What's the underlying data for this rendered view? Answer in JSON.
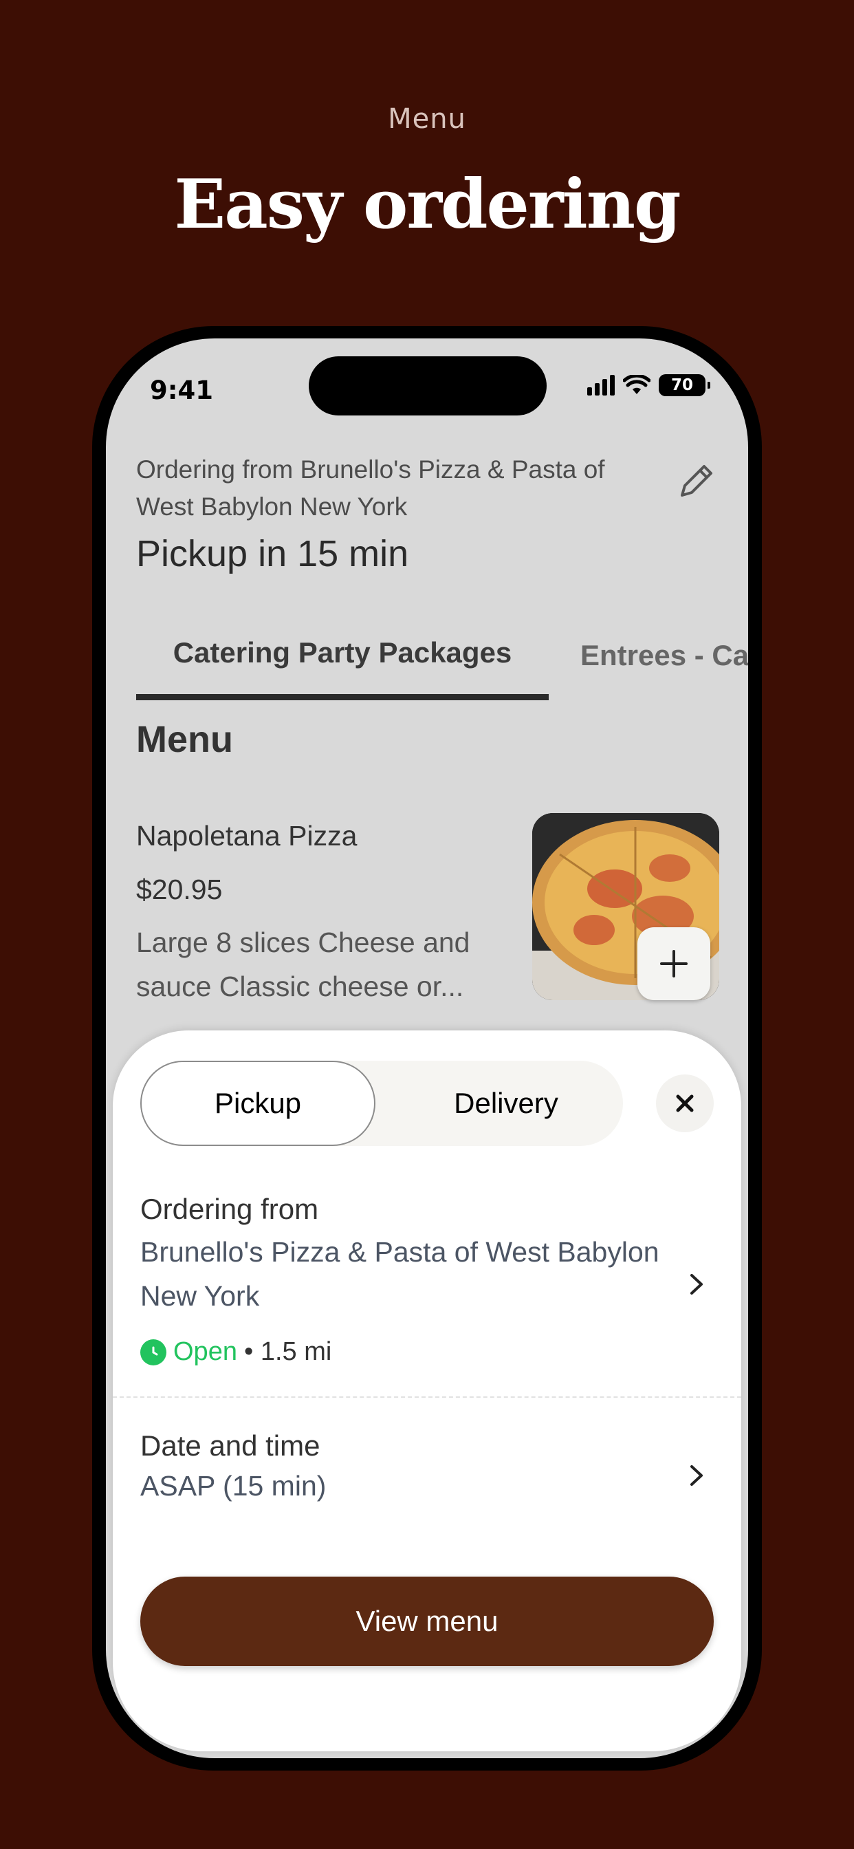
{
  "promo": {
    "subtitle": "Menu",
    "title": "Easy ordering"
  },
  "status_bar": {
    "time": "9:41",
    "battery": "70"
  },
  "header": {
    "ordering_from": "Ordering from Brunello's Pizza & Pasta of West Babylon New York",
    "pickup": "Pickup in 15 min"
  },
  "tabs": [
    {
      "label": "Catering Party Packages"
    },
    {
      "label": "Entrees - Ca"
    }
  ],
  "menu": {
    "section_title": "Menu",
    "item": {
      "name": "Napoletana Pizza",
      "price": "$20.95",
      "description": "Large 8 slices Cheese and sauce Classic cheese or..."
    }
  },
  "sheet": {
    "toggle": {
      "pickup": "Pickup",
      "delivery": "Delivery"
    },
    "ordering_from_label": "Ordering from",
    "store_name": "Brunello's Pizza & Pasta of West Babylon New York",
    "open_status": "Open",
    "distance": "• 1.5 mi",
    "date_time_label": "Date and time",
    "date_time_value": "ASAP (15 min)",
    "cta": "View menu"
  },
  "colors": {
    "background": "#3d0e04",
    "cta": "#5c2912",
    "open": "#22c35e"
  }
}
